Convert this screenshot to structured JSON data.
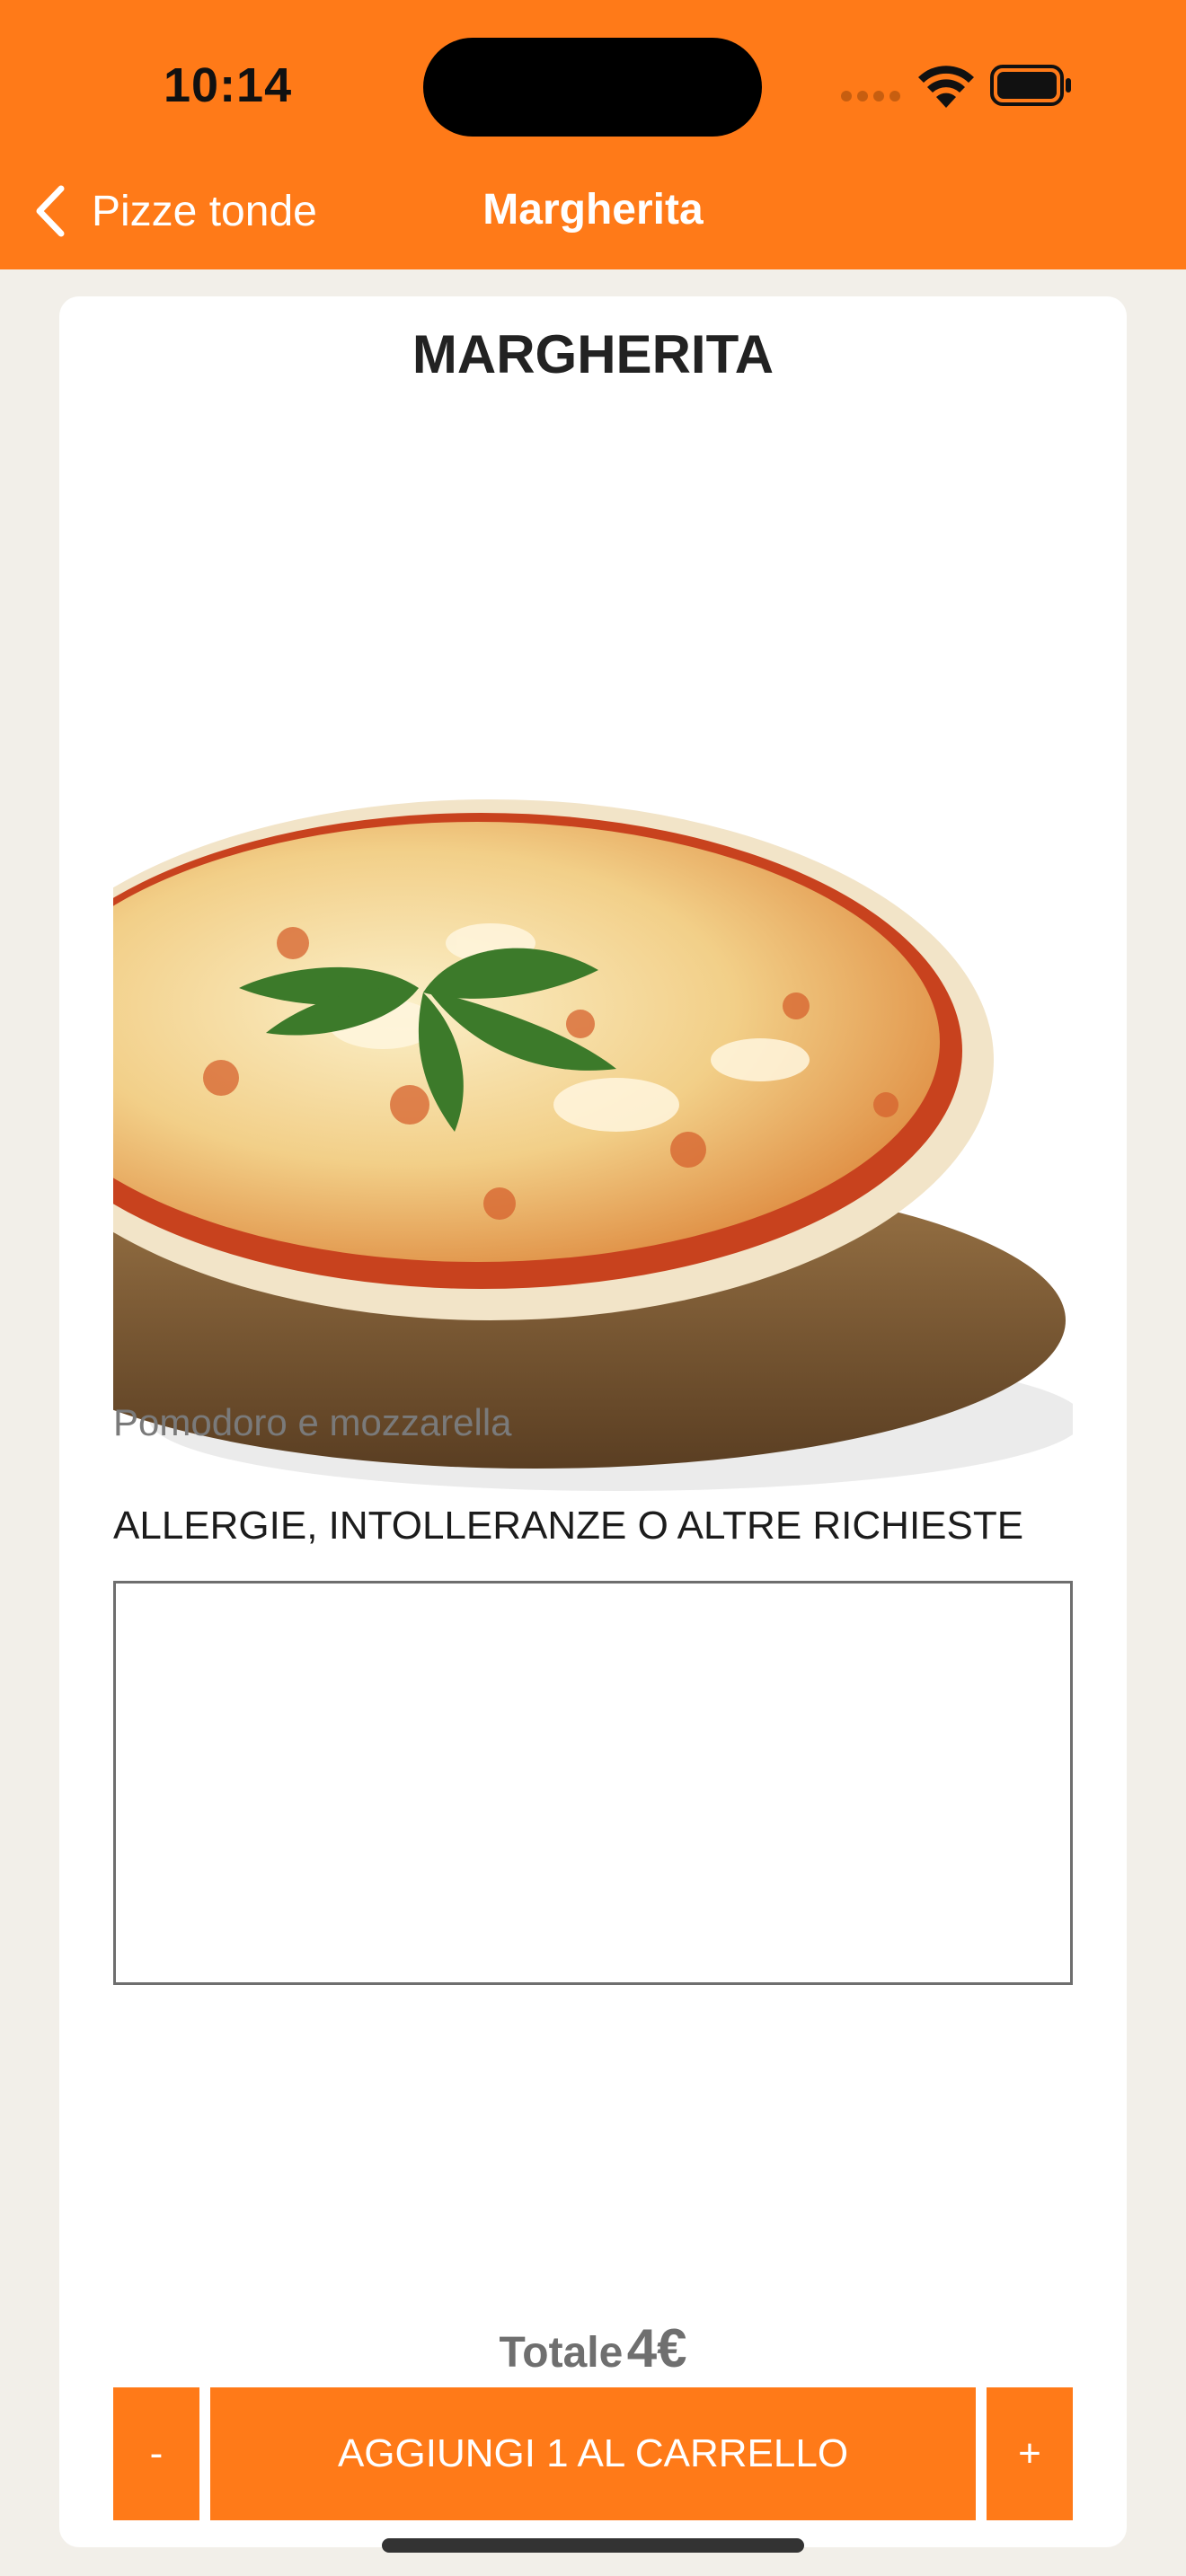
{
  "status_bar": {
    "time": "10:14",
    "icons": [
      "cellular-signal-icon",
      "wifi-icon",
      "battery-icon"
    ]
  },
  "nav": {
    "back_label": "Pizze tonde",
    "title": "Margherita"
  },
  "product": {
    "name": "MARGHERITA",
    "description": "Pomodoro e mozzarella",
    "notes_label": "ALLERGIE, INTOLLERANZE O ALTRE RICHIESTE",
    "notes_value": "",
    "total_label": "Totale",
    "total_amount": "4€"
  },
  "actions": {
    "minus_label": "-",
    "add_label": "AGGIUNGI 1 AL CARRELLO",
    "plus_label": "+"
  },
  "colors": {
    "accent": "#FF7A18",
    "background": "#F2EFE9"
  }
}
